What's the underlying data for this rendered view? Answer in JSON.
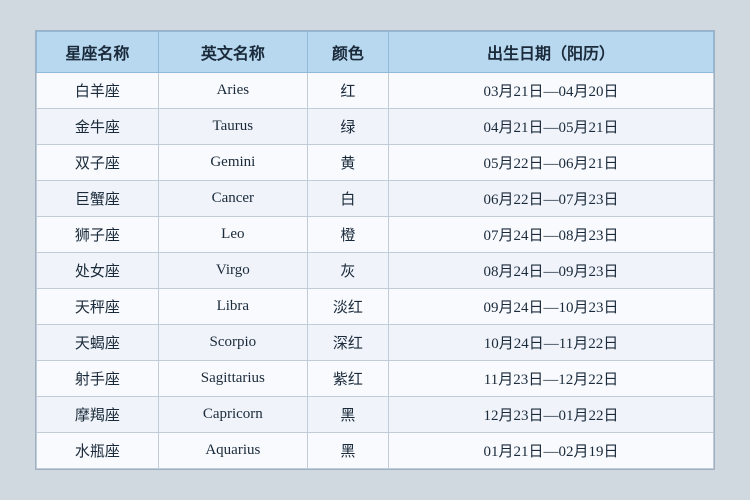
{
  "table": {
    "headers": {
      "chinese_name": "星座名称",
      "english_name": "英文名称",
      "color": "颜色",
      "birth_date": "出生日期（阳历）"
    },
    "rows": [
      {
        "chinese": "白羊座",
        "english": "Aries",
        "color": "红",
        "date": "03月21日—04月20日"
      },
      {
        "chinese": "金牛座",
        "english": "Taurus",
        "color": "绿",
        "date": "04月21日—05月21日"
      },
      {
        "chinese": "双子座",
        "english": "Gemini",
        "color": "黄",
        "date": "05月22日—06月21日"
      },
      {
        "chinese": "巨蟹座",
        "english": "Cancer",
        "color": "白",
        "date": "06月22日—07月23日"
      },
      {
        "chinese": "狮子座",
        "english": "Leo",
        "color": "橙",
        "date": "07月24日—08月23日"
      },
      {
        "chinese": "处女座",
        "english": "Virgo",
        "color": "灰",
        "date": "08月24日—09月23日"
      },
      {
        "chinese": "天秤座",
        "english": "Libra",
        "color": "淡红",
        "date": "09月24日—10月23日"
      },
      {
        "chinese": "天蝎座",
        "english": "Scorpio",
        "color": "深红",
        "date": "10月24日—11月22日"
      },
      {
        "chinese": "射手座",
        "english": "Sagittarius",
        "color": "紫红",
        "date": "11月23日—12月22日"
      },
      {
        "chinese": "摩羯座",
        "english": "Capricorn",
        "color": "黑",
        "date": "12月23日—01月22日"
      },
      {
        "chinese": "水瓶座",
        "english": "Aquarius",
        "color": "黑",
        "date": "01月21日—02月19日"
      }
    ]
  }
}
